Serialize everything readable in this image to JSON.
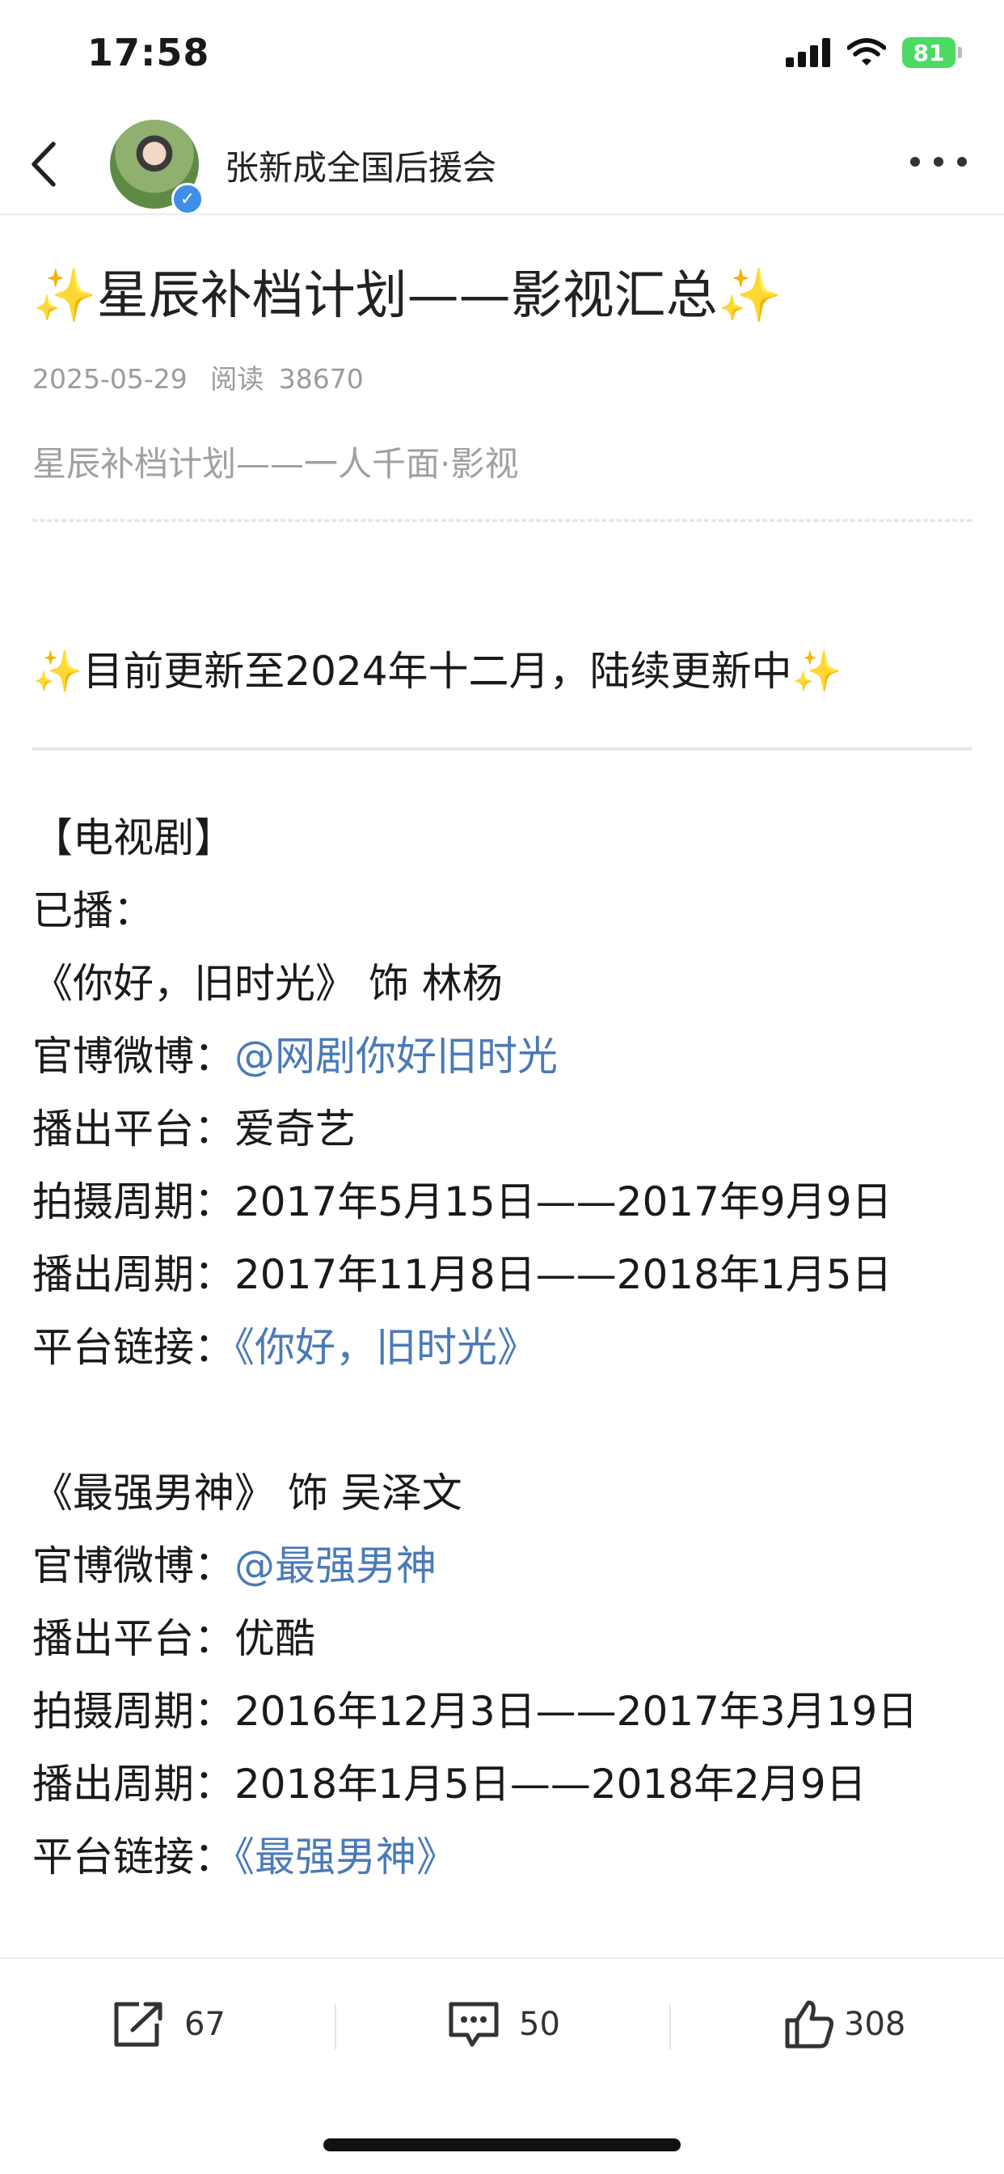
{
  "status_bar": {
    "time": "17:58",
    "battery": "81",
    "icons": [
      "cellular-signal-icon",
      "wifi-icon",
      "battery-icon"
    ]
  },
  "nav": {
    "account_name": "张新成全国后援会",
    "icons": [
      "back-chevron-icon",
      "avatar",
      "verified-badge-icon",
      "more-icon"
    ]
  },
  "article": {
    "title": "✨星辰补档计划——影视汇总✨",
    "date": "2025-05-29",
    "reads_label": "阅读",
    "reads_count": "38670",
    "subtitle": "星辰补档计划——一人千面·影视",
    "notice": "✨目前更新至2024年十二月，陆续更新中✨",
    "section_header": "【电视剧】",
    "aired_label": "已播：",
    "show1": {
      "title_line": "《你好，旧时光》 饰 林杨",
      "weibo_label": "官博微博：",
      "weibo_link": "@网剧你好旧时光",
      "platform_label": "播出平台：",
      "platform": "爱奇艺",
      "filming_label": "拍摄周期：",
      "filming": "2017年5月15日——2017年9月9日",
      "airing_label": "播出周期：",
      "airing": "2017年11月8日——2018年1月5日",
      "link_label": "平台链接：",
      "link": "《你好，旧时光》"
    },
    "show2": {
      "title_line": "《最强男神》 饰 吴泽文",
      "weibo_label": "官博微博：",
      "weibo_link": "@最强男神",
      "platform_label": "播出平台：",
      "platform": "优酷",
      "filming_label": "拍摄周期：",
      "filming": "2016年12月3日——2017年3月19日",
      "airing_label": "播出周期：",
      "airing": "2018年1月5日——2018年2月9日",
      "link_label": "平台链接：",
      "link": "《最强男神》"
    }
  },
  "actions": {
    "share_count": "67",
    "comment_count": "50",
    "like_count": "308",
    "icons": [
      "share-icon",
      "comment-icon",
      "like-icon"
    ]
  },
  "colors": {
    "link": "#4a7ab8",
    "meta_gray": "#9b9b9b",
    "battery_green": "#4cd964",
    "verified_blue": "#3d8fe8"
  }
}
